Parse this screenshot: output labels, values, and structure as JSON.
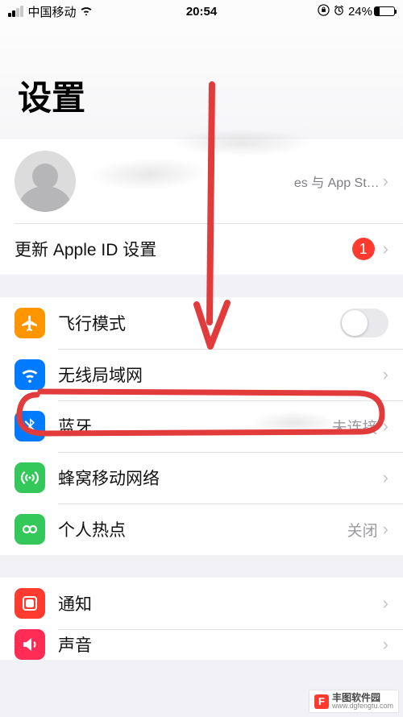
{
  "status": {
    "carrier": "中国移动",
    "time": "20:54",
    "battery_pct": "24%"
  },
  "title": "设置",
  "profile": {
    "subtitle_suffix": "es 与 App St…"
  },
  "apple_id_row": {
    "label": "更新 Apple ID 设置",
    "badge": "1"
  },
  "rows": {
    "airplane": "飞行模式",
    "wifi": "无线局域网",
    "bluetooth": "蓝牙",
    "bluetooth_value": "未连接",
    "cellular": "蜂窝移动网络",
    "hotspot": "个人热点",
    "hotspot_value": "关闭",
    "notifications": "通知",
    "sounds": "声音"
  },
  "watermark": {
    "name": "丰图软件园",
    "url": "www.dgfengtu.com"
  },
  "colors": {
    "airplane": "#ff9500",
    "wifi": "#007aff",
    "bluetooth": "#007aff",
    "cellular": "#34c759",
    "hotspot": "#34c759",
    "notifications": "#ff3b30",
    "sounds": "#ff2d55"
  }
}
